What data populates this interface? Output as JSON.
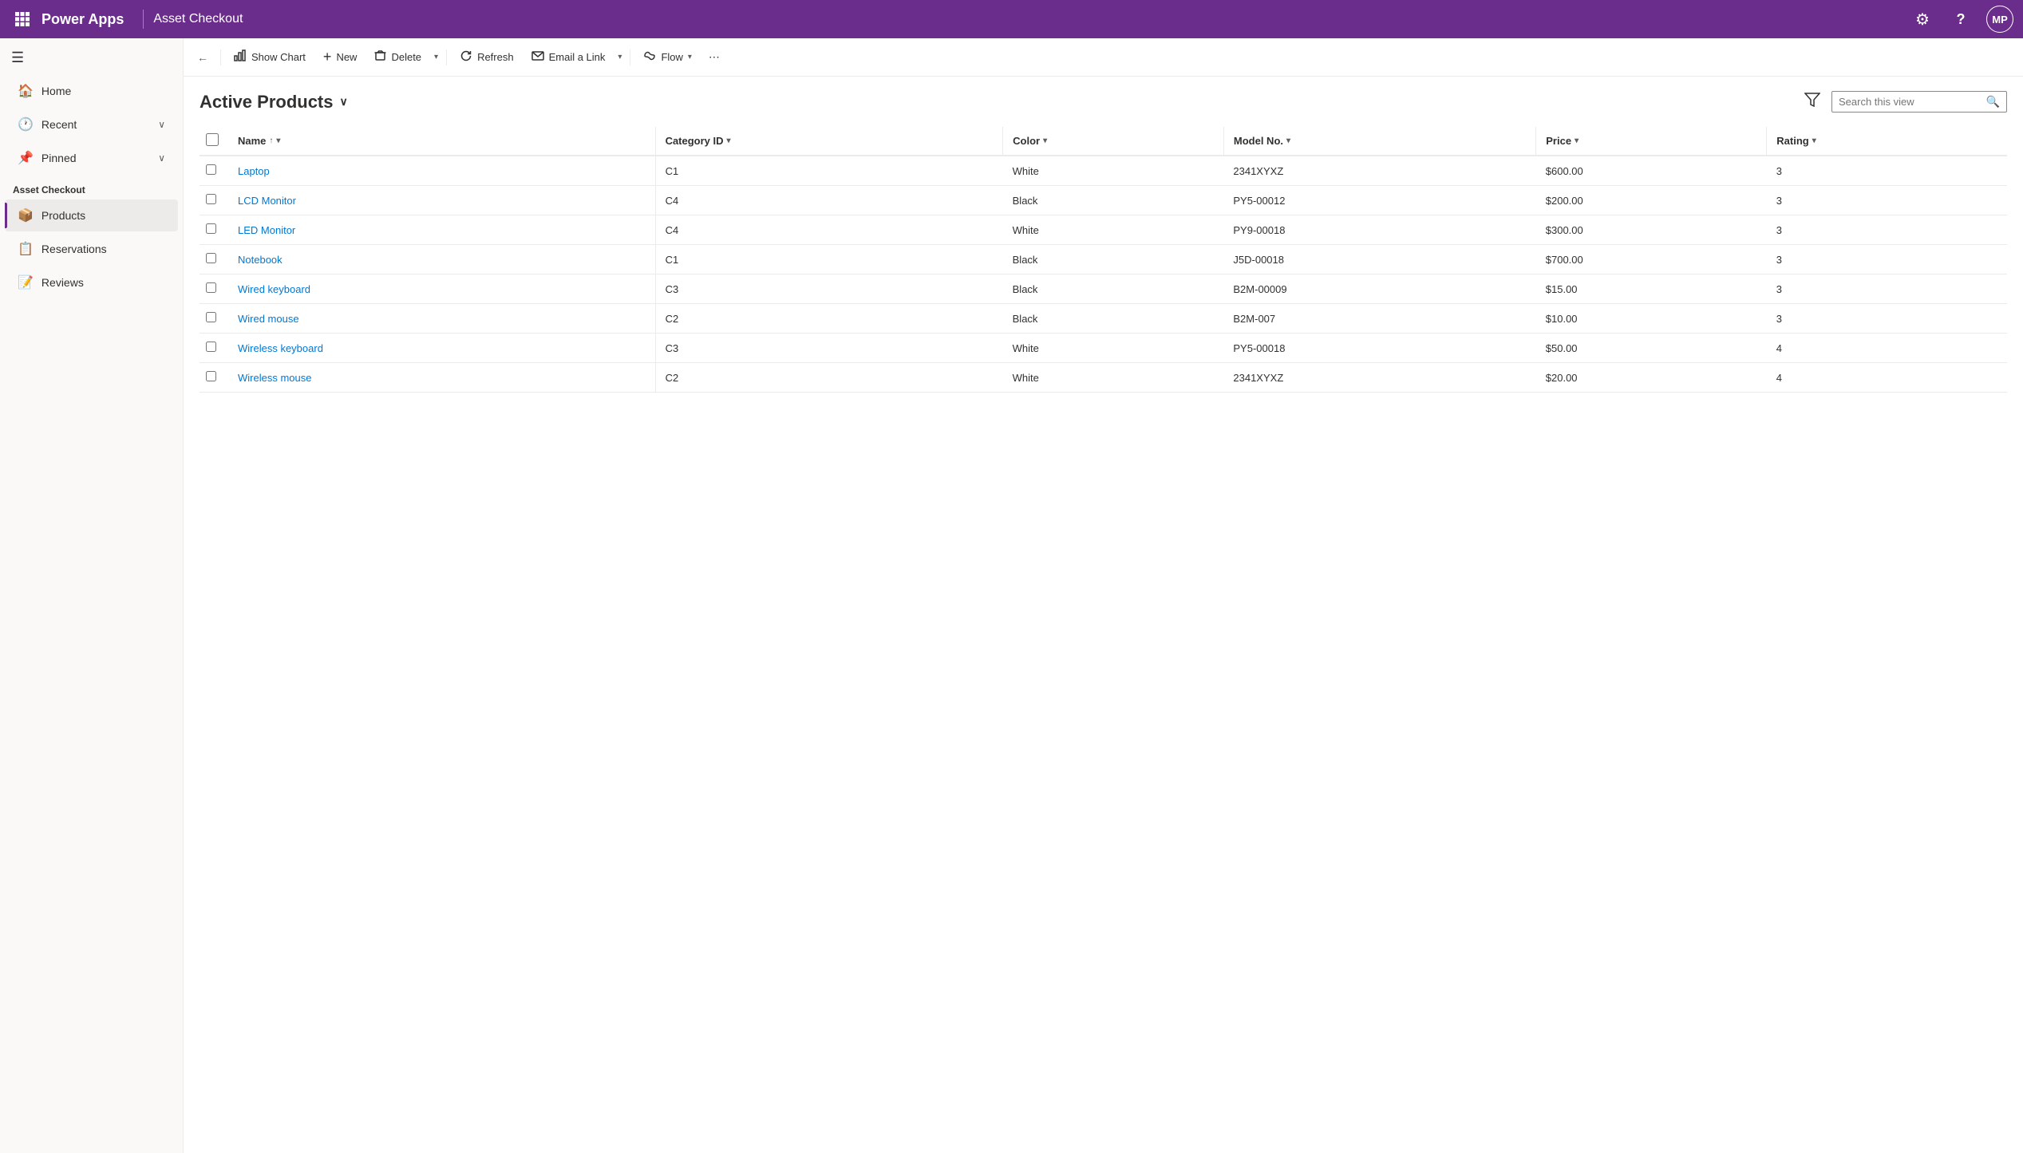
{
  "topbar": {
    "app_name": "Power Apps",
    "page_name": "Asset Checkout",
    "settings_label": "Settings",
    "help_label": "Help",
    "avatar_initials": "MP"
  },
  "sidebar": {
    "hamburger_label": "Navigation menu",
    "nav_items": [
      {
        "id": "home",
        "label": "Home",
        "icon": "⌂"
      },
      {
        "id": "recent",
        "label": "Recent",
        "icon": "⏱",
        "has_chevron": true
      },
      {
        "id": "pinned",
        "label": "Pinned",
        "icon": "📌",
        "has_chevron": true
      }
    ],
    "section_label": "Asset Checkout",
    "app_items": [
      {
        "id": "products",
        "label": "Products",
        "icon": "📦",
        "active": true
      },
      {
        "id": "reservations",
        "label": "Reservations",
        "icon": "📋",
        "active": false
      },
      {
        "id": "reviews",
        "label": "Reviews",
        "icon": "📝",
        "active": false
      }
    ]
  },
  "commandbar": {
    "back_label": "Back",
    "show_chart_label": "Show Chart",
    "new_label": "New",
    "delete_label": "Delete",
    "refresh_label": "Refresh",
    "email_link_label": "Email a Link",
    "flow_label": "Flow",
    "more_label": "More"
  },
  "view": {
    "title": "Active Products",
    "filter_label": "Filter",
    "search_placeholder": "Search this view"
  },
  "table": {
    "columns": [
      {
        "id": "name",
        "label": "Name",
        "sortable": true,
        "sort_dir": "asc"
      },
      {
        "id": "category_id",
        "label": "Category ID",
        "sortable": true
      },
      {
        "id": "color",
        "label": "Color",
        "sortable": true
      },
      {
        "id": "model_no",
        "label": "Model No.",
        "sortable": true
      },
      {
        "id": "price",
        "label": "Price",
        "sortable": true
      },
      {
        "id": "rating",
        "label": "Rating",
        "sortable": true
      }
    ],
    "rows": [
      {
        "name": "Laptop",
        "category_id": "C1",
        "color": "White",
        "model_no": "2341XYXZ",
        "price": "$600.00",
        "rating": "3"
      },
      {
        "name": "LCD Monitor",
        "category_id": "C4",
        "color": "Black",
        "model_no": "PY5-00012",
        "price": "$200.00",
        "rating": "3"
      },
      {
        "name": "LED Monitor",
        "category_id": "C4",
        "color": "White",
        "model_no": "PY9-00018",
        "price": "$300.00",
        "rating": "3"
      },
      {
        "name": "Notebook",
        "category_id": "C1",
        "color": "Black",
        "model_no": "J5D-00018",
        "price": "$700.00",
        "rating": "3"
      },
      {
        "name": "Wired keyboard",
        "category_id": "C3",
        "color": "Black",
        "model_no": "B2M-00009",
        "price": "$15.00",
        "rating": "3"
      },
      {
        "name": "Wired mouse",
        "category_id": "C2",
        "color": "Black",
        "model_no": "B2M-007",
        "price": "$10.00",
        "rating": "3"
      },
      {
        "name": "Wireless keyboard",
        "category_id": "C3",
        "color": "White",
        "model_no": "PY5-00018",
        "price": "$50.00",
        "rating": "4"
      },
      {
        "name": "Wireless mouse",
        "category_id": "C2",
        "color": "White",
        "model_no": "2341XYXZ",
        "price": "$20.00",
        "rating": "4"
      }
    ]
  }
}
